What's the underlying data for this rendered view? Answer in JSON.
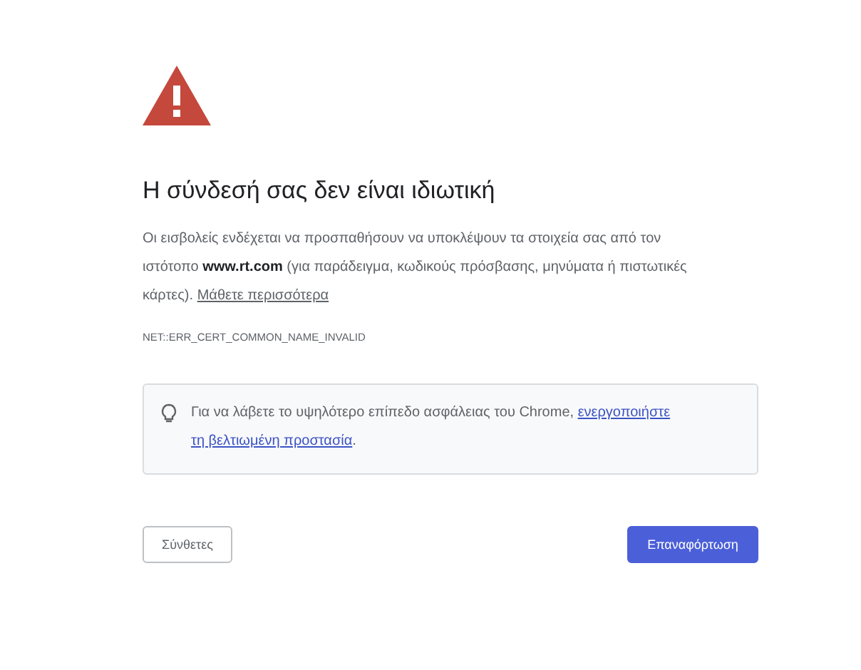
{
  "heading": "Η σύνδεσή σας δεν είναι ιδιωτική",
  "body": {
    "text": "Οι εισβολείς ενδέχεται να προσπαθήσουν να υποκλέψουν τα στοιχεία σας από τον ιστότοπο **www.rt.com** (για παράδειγμα, κωδικούς πρόσβασης, μηνύματα ή πιστωτικές κάρτες).",
    "link": "Μάθετε περισσότερα"
  },
  "error_code": "NET::ERR_CERT_COMMON_NAME_INVALID",
  "tip": {
    "text": "Για να λάβετε το υψηλότερο επίπεδο ασφάλειας του Chrome,",
    "link_lines": [
      "ενεργοποιήστε",
      "τη βελτιωμένη προστασία"
    ],
    "end": "."
  },
  "buttons": [
    {
      "label": "Σύνθετες",
      "kind": "secondary"
    },
    {
      "label": "Επαναφόρτωση",
      "kind": "primary"
    }
  ]
}
